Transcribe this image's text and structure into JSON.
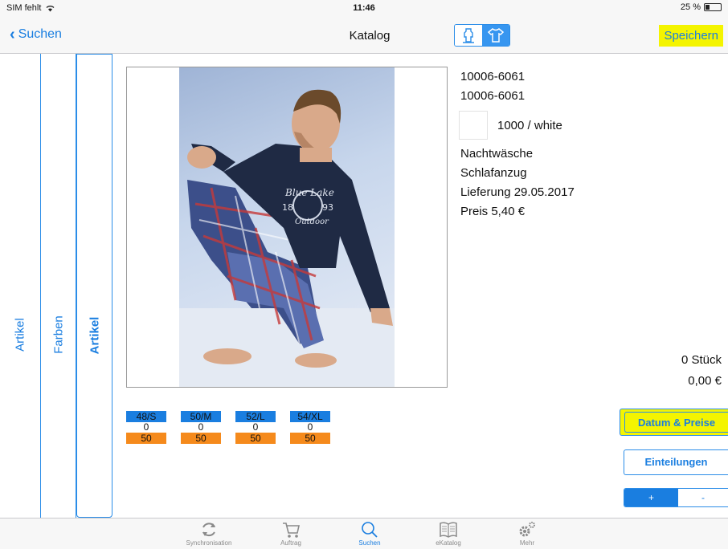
{
  "status": {
    "carrier": "SIM fehlt",
    "time": "11:46",
    "battery": "25 %"
  },
  "nav": {
    "back_label": "Suchen",
    "title": "Katalog",
    "save_label": "Speichern"
  },
  "sidebar": {
    "columns": [
      "Artikel",
      "Farben",
      "Artikel"
    ]
  },
  "product": {
    "article_no": "10006-6061",
    "model_no": "10006-6061",
    "color": "1000 / white",
    "category": "Nachtwäsche",
    "type": "Schlafanzug",
    "delivery": "Lieferung 29.05.2017",
    "price": "Preis 5,40 €"
  },
  "sizes": [
    {
      "label": "48/S",
      "qty": "0",
      "stock": "50"
    },
    {
      "label": "50/M",
      "qty": "0",
      "stock": "50"
    },
    {
      "label": "52/L",
      "qty": "0",
      "stock": "50"
    },
    {
      "label": "54/XL",
      "qty": "0",
      "stock": "50"
    }
  ],
  "totals": {
    "pieces": "0 Stück",
    "amount": "0,00 €"
  },
  "actions": {
    "date_prices": "Datum & Preise",
    "divisions": "Einteilungen",
    "plus": "+",
    "minus": "-"
  },
  "tabs": [
    {
      "label": "Synchronisation",
      "icon": "sync-icon"
    },
    {
      "label": "Auftrag",
      "icon": "cart-icon"
    },
    {
      "label": "Suchen",
      "icon": "search-icon"
    },
    {
      "label": "eKatalog",
      "icon": "book-icon"
    },
    {
      "label": "Mehr",
      "icon": "gear-icon"
    }
  ],
  "colors": {
    "accent": "#1a7ee0",
    "highlight": "#f4f400",
    "stock": "#f58a1c"
  }
}
